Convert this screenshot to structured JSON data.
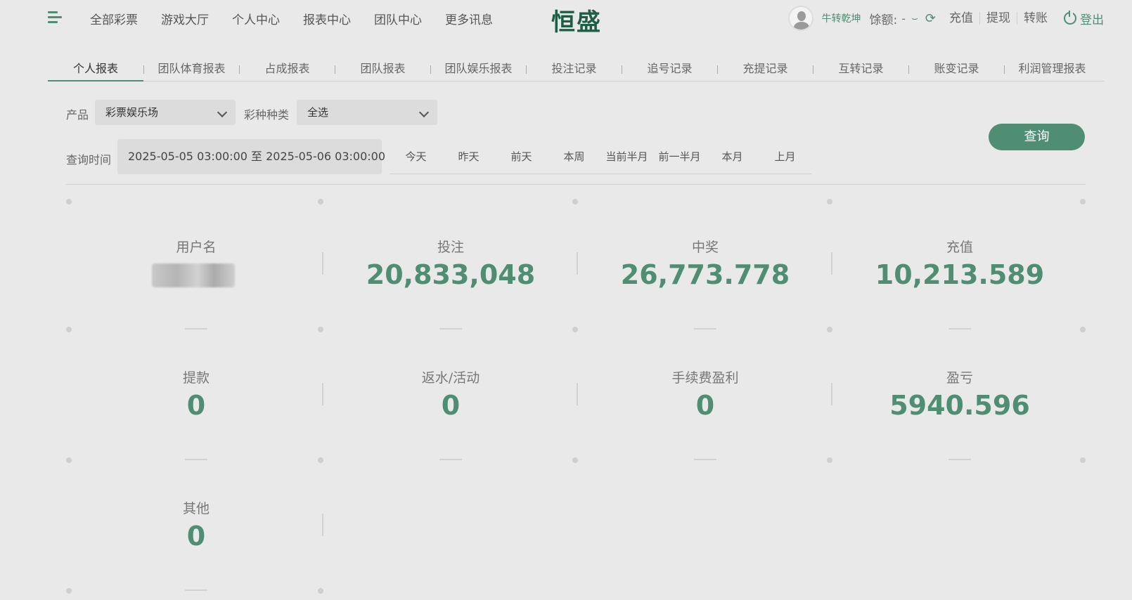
{
  "header": {
    "nav": [
      "全部彩票",
      "游戏大厅",
      "个人中心",
      "报表中心",
      "团队中心",
      "更多讯息"
    ],
    "logo": "恒盛",
    "username": "牛转乾坤",
    "balance_label": "馀额:",
    "balance_value": "-",
    "links": [
      "充值",
      "提现",
      "转账"
    ],
    "logout": "登出"
  },
  "tabs": [
    "个人报表",
    "团队体育报表",
    "占成报表",
    "团队报表",
    "团队娱乐报表",
    "投注记录",
    "追号记录",
    "充提记录",
    "互转记录",
    "账变记录",
    "利润管理报表"
  ],
  "active_tab": 0,
  "filters": {
    "product_label": "产品",
    "product_value": "彩票娱乐场",
    "type_label": "彩种种类",
    "type_value": "全选",
    "time_label": "查询时间",
    "date_range": "2025-05-05 03:00:00 至 2025-05-06 03:00:00",
    "quick_dates": [
      "今天",
      "昨天",
      "前天",
      "本周",
      "当前半月",
      "前一半月",
      "本月",
      "上月"
    ],
    "query_button": "查询"
  },
  "stats": [
    {
      "label": "用户名",
      "value": ""
    },
    {
      "label": "投注",
      "value": "20,833,048"
    },
    {
      "label": "中奖",
      "value": "26,773.778"
    },
    {
      "label": "充值",
      "value": "10,213.589"
    },
    {
      "label": "提款",
      "value": "0"
    },
    {
      "label": "返水/活动",
      "value": "0"
    },
    {
      "label": "手续费盈利",
      "value": "0"
    },
    {
      "label": "盈亏",
      "value": "5940.596"
    },
    {
      "label": "其他",
      "value": "0"
    }
  ]
}
